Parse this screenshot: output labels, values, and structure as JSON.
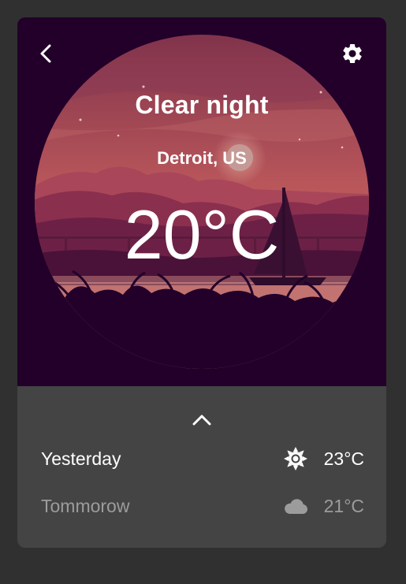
{
  "header": {
    "back_icon": "chevron-left-icon",
    "settings_icon": "gear-icon"
  },
  "current": {
    "condition": "Clear night",
    "location": "Detroit, US",
    "temperature": "20°C"
  },
  "forecast": {
    "expand_icon": "chevron-up-icon",
    "rows": [
      {
        "day": "Yesterday",
        "icon": "sun-icon",
        "temperature": "23°C"
      },
      {
        "day": "Tommorow",
        "icon": "cloud-icon",
        "temperature": "21°C"
      }
    ]
  },
  "colors": {
    "page_background": "#303030",
    "hero_background": "#22002a",
    "panel_background": "#444444",
    "primary_text": "#ffffff",
    "secondary_text": "#9c9c9c"
  }
}
